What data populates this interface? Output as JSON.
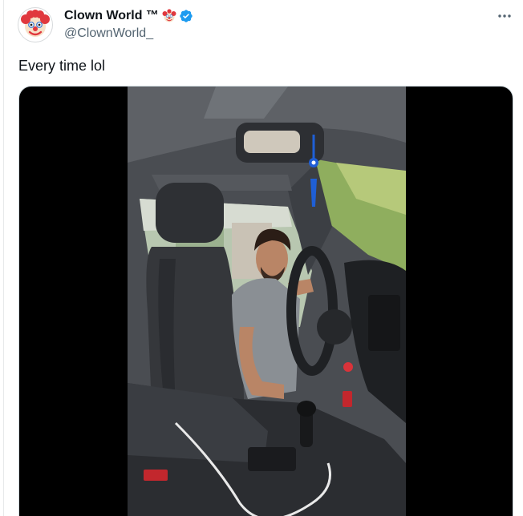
{
  "tweet": {
    "author": {
      "display_name": "Clown World ™",
      "handle": "@ClownWorld_",
      "avatar_icon": "clown-face-icon",
      "name_emoji_icon": "clown-face-icon",
      "verified_icon": "verified-badge-icon",
      "verified_color": "#1d9bf0"
    },
    "more_icon": "more-horizontal-icon",
    "text": "Every time lol",
    "media": {
      "type": "video",
      "subject": "man-reaching-into-car-icon"
    }
  },
  "colors": {
    "text_primary": "#0f1419",
    "text_secondary": "#536471",
    "border": "#cfd9de",
    "media_background": "#000000"
  }
}
